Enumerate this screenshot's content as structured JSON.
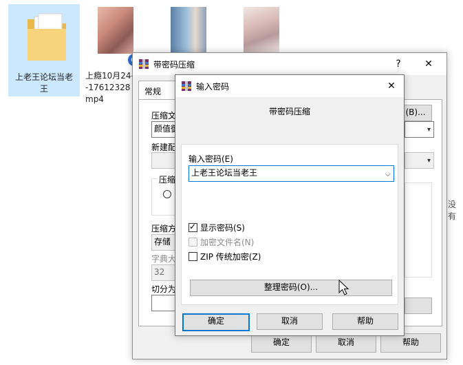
{
  "desktop": {
    "items": [
      {
        "label": "上老王论坛当老王"
      },
      {
        "label": "上瘾10月24--17612328 mp4"
      },
      {
        "label": ""
      },
      {
        "label": ""
      }
    ],
    "side_text": "没有"
  },
  "parent_dialog": {
    "title": "带密码压缩",
    "help_glyph": "?",
    "close_glyph": "✕",
    "tab": "常规",
    "fields": {
      "archive_label": "压缩文",
      "archive_value": "颜值御",
      "browse_label": "(B)...",
      "new_config_label": "新建配",
      "group_label": "压缩文",
      "radio_label": "R",
      "method_label": "压缩方",
      "method_value": "存储",
      "dict_label": "字典大",
      "dict_value": "32",
      "split_label": "切分为"
    },
    "buttons": {
      "ok": "确定",
      "cancel": "取消",
      "help": "帮助"
    }
  },
  "password_dialog": {
    "title": "输入密码",
    "close_glyph": "✕",
    "heading": "带密码压缩",
    "password_label": "输入密码(E)",
    "password_value": "上老王论坛当老王",
    "show_password": {
      "label": "显示密码(S)",
      "checked": true
    },
    "encrypt_filenames": {
      "label": "加密文件名(N)",
      "checked": false,
      "disabled": true
    },
    "zip_legacy": {
      "label": "ZIP 传统加密(Z)",
      "checked": false
    },
    "organize_button": "整理密码(O)...",
    "buttons": {
      "ok": "确定",
      "cancel": "取消",
      "help": "帮助"
    }
  },
  "colors": {
    "accent": "#0078d7",
    "dialog_bg": "#f0f0f0",
    "selected_bg": "#cce8ff"
  }
}
